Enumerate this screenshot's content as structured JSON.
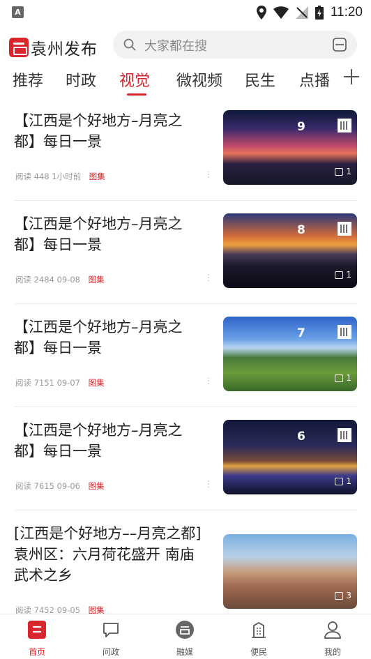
{
  "status_bar": {
    "time": "11:20"
  },
  "header": {
    "app_name": "袁州发布",
    "search_placeholder": "大家都在搜"
  },
  "tabs": [
    {
      "label": "推荐"
    },
    {
      "label": "时政"
    },
    {
      "label": "视觉",
      "active": true
    },
    {
      "label": "微视频"
    },
    {
      "label": "民生"
    },
    {
      "label": "点播"
    }
  ],
  "articles": [
    {
      "title": "【江西是个好地方–月亮之都】每日一景",
      "reads": "阅读 448",
      "time": "1小时前",
      "tag": "图集",
      "photo_count": "1",
      "day": "9"
    },
    {
      "title": "【江西是个好地方–月亮之都】每日一景",
      "reads": "阅读 2484",
      "time": "09-08",
      "tag": "图集",
      "photo_count": "1",
      "day": "8"
    },
    {
      "title": "【江西是个好地方–月亮之都】每日一景",
      "reads": "阅读 7151",
      "time": "09-07",
      "tag": "图集",
      "photo_count": "1",
      "day": "7"
    },
    {
      "title": "【江西是个好地方–月亮之都】每日一景",
      "reads": "阅读 7615",
      "time": "09-06",
      "tag": "图集",
      "photo_count": "1",
      "day": "6"
    },
    {
      "title": "[江西是个好地方––月亮之都]袁州区：六月荷花盛开 南庙武术之乡",
      "reads": "阅读 7452",
      "time": "09-05",
      "tag": "图集",
      "photo_count": "3",
      "day": ""
    }
  ],
  "bottom_nav": [
    {
      "label": "首页",
      "icon": "home-icon",
      "active": true
    },
    {
      "label": "问政",
      "icon": "chat-icon"
    },
    {
      "label": "融媒",
      "icon": "media-icon"
    },
    {
      "label": "便民",
      "icon": "building-icon"
    },
    {
      "label": "我的",
      "icon": "profile-icon"
    }
  ],
  "colors": {
    "accent": "#d9262c",
    "text": "#222222",
    "muted": "#999999"
  }
}
